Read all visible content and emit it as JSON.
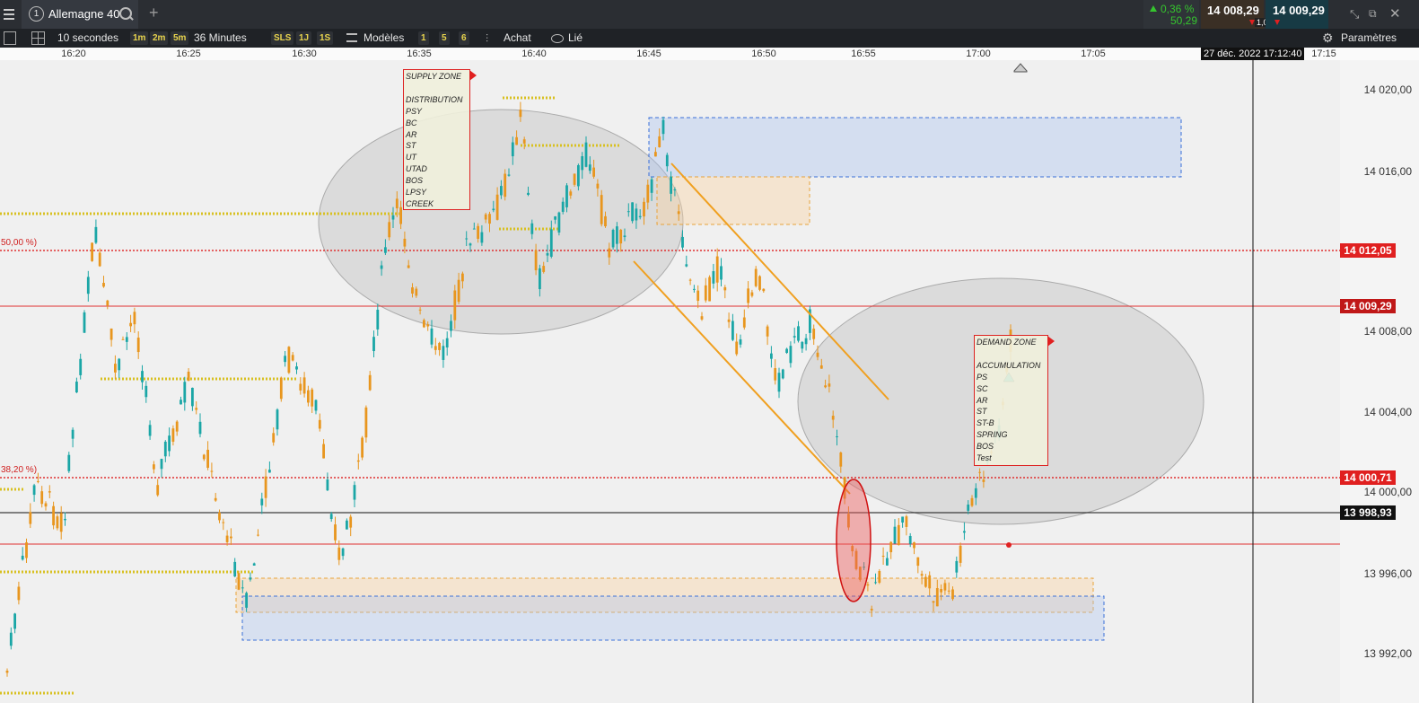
{
  "topbar": {
    "instrument_number": "1",
    "instrument_name": "Allemagne 40",
    "change_pct": "0,36 %",
    "change_abs": "50,29",
    "bid": "14 008,29",
    "ask": "14 009,29",
    "spread": "1,00"
  },
  "toolbar": {
    "interval": "10 secondes",
    "tf_1m": "1m",
    "tf_2m": "2m",
    "tf_5m": "5m",
    "range": "36 Minutes",
    "sls": "SLS",
    "one_day": "1J",
    "one_week": "1S",
    "models": "Modèles",
    "m1": "1",
    "m5": "5",
    "m6": "6",
    "buy": "Achat",
    "linked": "Lié",
    "settings": "Paramètres"
  },
  "time_axis": {
    "ticks": [
      "16:20",
      "16:25",
      "16:30",
      "16:35",
      "16:40",
      "16:45",
      "16:50",
      "16:55",
      "17:00",
      "17:05",
      "17:15"
    ],
    "cursor_date": "27 déc. 2022 17:12:40"
  },
  "price_axis": {
    "labels": [
      "14 020,00",
      "14 016,00",
      "14 008,00",
      "14 004,00",
      "14 000,00",
      "13 996,00",
      "13 992,00"
    ],
    "fib_50_label": "14 012,05",
    "current_label": "14 009,29",
    "fib_382_label": "14 000,71",
    "cross_label": "13 998,93"
  },
  "fib": {
    "pct_50": "50,00 %)",
    "pct_382": "38,20 %)"
  },
  "supply_zone": {
    "title": "SUPPLY ZONE",
    "lines": [
      "",
      "DISTRIBUTION",
      "PSY",
      "BC",
      "AR",
      "ST",
      "UT",
      "UTAD",
      "BOS",
      "LPSY",
      "CREEK"
    ]
  },
  "demand_zone": {
    "title": "DEMAND ZONE",
    "lines": [
      "",
      "ACCUMULATION",
      "PS",
      "SC",
      "AR",
      "ST",
      "ST-B",
      "SPRING",
      "BOS",
      "Test"
    ]
  },
  "colors": {
    "up": "#1aa6a6",
    "down": "#e8961e",
    "fib": "#e03030",
    "bid_bg": "#3a2f25",
    "ask_bg": "#173a44",
    "positive": "#35c52e"
  }
}
